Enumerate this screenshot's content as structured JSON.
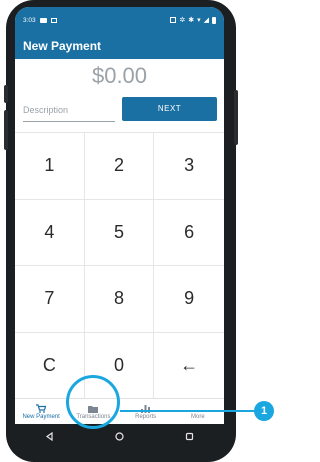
{
  "status_bar": {
    "time": "3:03",
    "right_icons": [
      "nfc-icon",
      "vibrate-icon",
      "bluetooth-icon",
      "wifi-icon",
      "signal-icon",
      "battery-icon"
    ]
  },
  "app_bar": {
    "title": "New Payment"
  },
  "payment": {
    "amount": "$0.00",
    "description_placeholder": "Description",
    "next_label": "NEXT"
  },
  "keypad": {
    "keys": [
      "1",
      "2",
      "3",
      "4",
      "5",
      "6",
      "7",
      "8",
      "9",
      "C",
      "0",
      "←"
    ]
  },
  "tabs": [
    {
      "label": "New Payment",
      "icon": "cart-icon",
      "active": true
    },
    {
      "label": "Transactions",
      "icon": "folder-icon",
      "active": false
    },
    {
      "label": "Reports",
      "icon": "bar-chart-icon",
      "active": false
    },
    {
      "label": "More",
      "icon": "more-dots-icon",
      "active": false
    }
  ],
  "callout": {
    "number": "1"
  },
  "colors": {
    "brand": "#1a6fa3",
    "callout": "#1aa7e0"
  }
}
